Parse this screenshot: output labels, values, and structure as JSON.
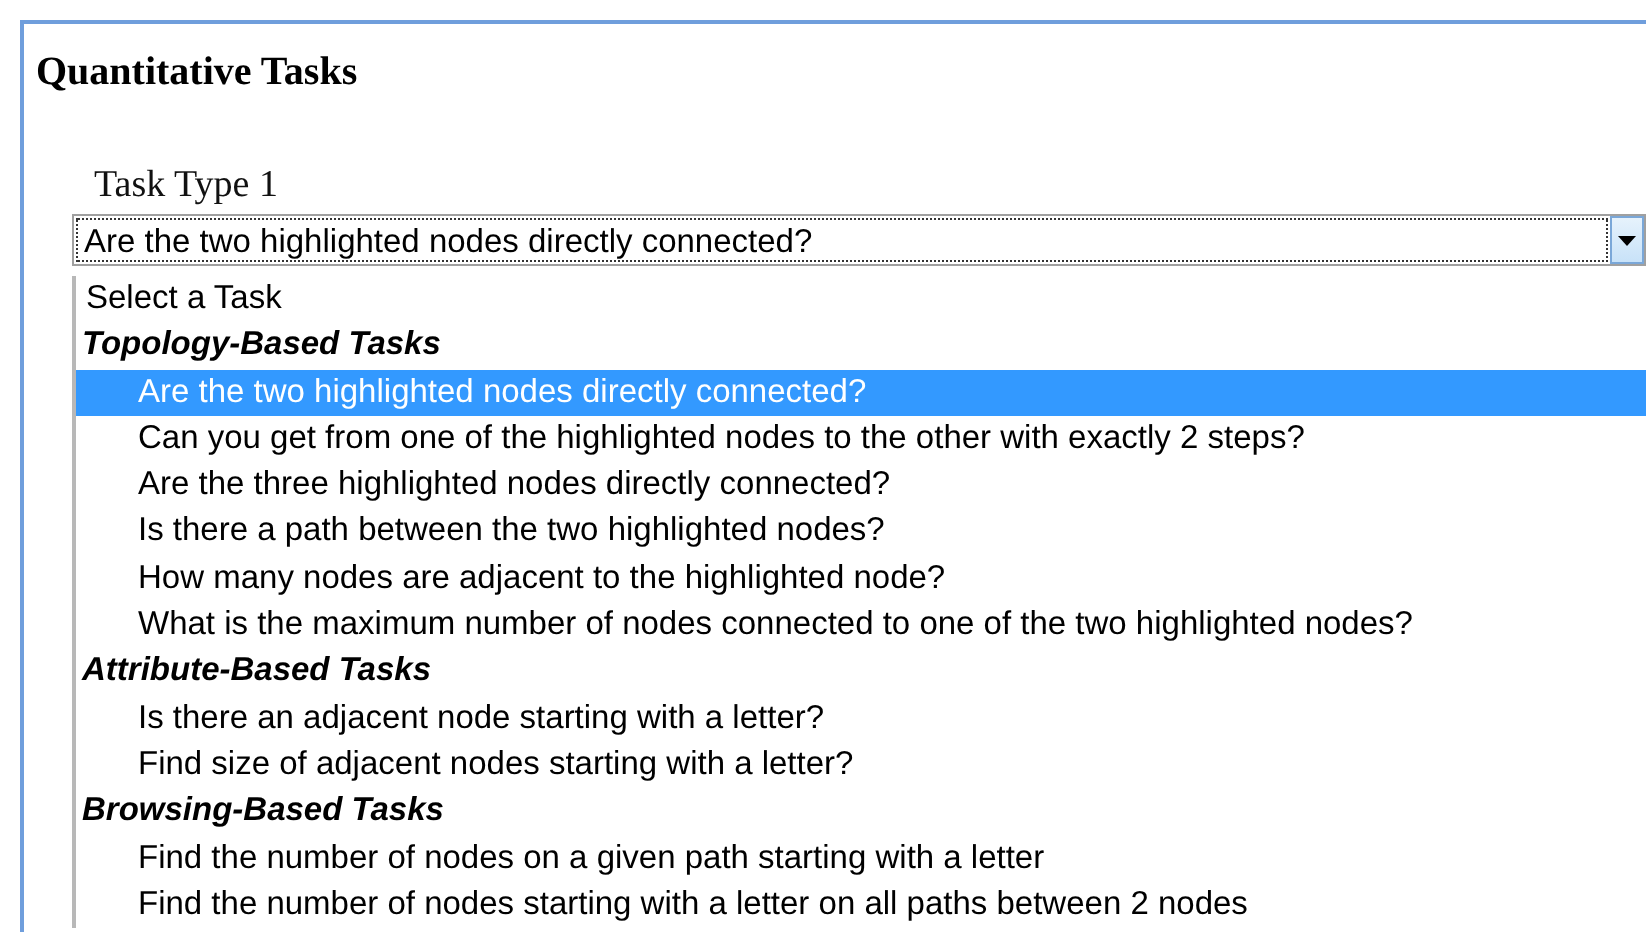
{
  "panel": {
    "title": "Quantitative Tasks"
  },
  "field": {
    "label": "Task Type 1",
    "value": "Are the two highlighted nodes directly connected?",
    "expanded": true
  },
  "dropdown": {
    "items": [
      {
        "kind": "option",
        "label": "Select a Task",
        "selected": false
      },
      {
        "kind": "group",
        "label": "Topology-Based Tasks",
        "options": [
          {
            "label": "Are the two highlighted nodes directly connected?",
            "selected": true
          },
          {
            "label": "Can you get from one of the highlighted nodes to the other with exactly 2 steps?",
            "selected": false
          },
          {
            "label": "Are the three highlighted nodes directly connected?",
            "selected": false
          },
          {
            "label": "Is there a path between the two highlighted nodes?",
            "selected": false
          },
          {
            "label": "How many nodes are adjacent to the highlighted node?",
            "selected": false
          },
          {
            "label": "What is the maximum number of nodes connected to one of the two highlighted nodes?",
            "selected": false
          }
        ]
      },
      {
        "kind": "group",
        "label": "Attribute-Based Tasks",
        "options": [
          {
            "label": "Is there an adjacent node starting with a letter?",
            "selected": false
          },
          {
            "label": "Find size of adjacent nodes starting with a letter?",
            "selected": false
          }
        ]
      },
      {
        "kind": "group",
        "label": "Browsing-Based Tasks",
        "options": [
          {
            "label": "Find the number of nodes on a given path starting with a letter",
            "selected": false
          },
          {
            "label": "Find the number of nodes starting with a letter on all paths between 2 nodes",
            "selected": false
          }
        ]
      }
    ]
  }
}
